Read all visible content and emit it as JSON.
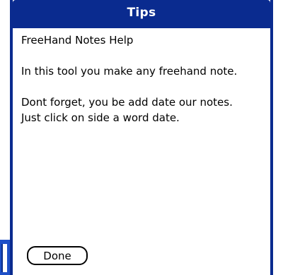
{
  "dialog": {
    "title": "Tips",
    "heading": "FreeHand Notes Help",
    "paragraph1": "In this tool you make any freehand note.",
    "paragraph2_line1": "Dont forget, you be add date our notes.",
    "paragraph2_line2": "Just click on side a word date.",
    "done_label": "Done"
  },
  "colors": {
    "title_bar": "#0a2b8f",
    "side_strip": "#1e50c8",
    "text": "#000000",
    "background": "#ffffff"
  }
}
